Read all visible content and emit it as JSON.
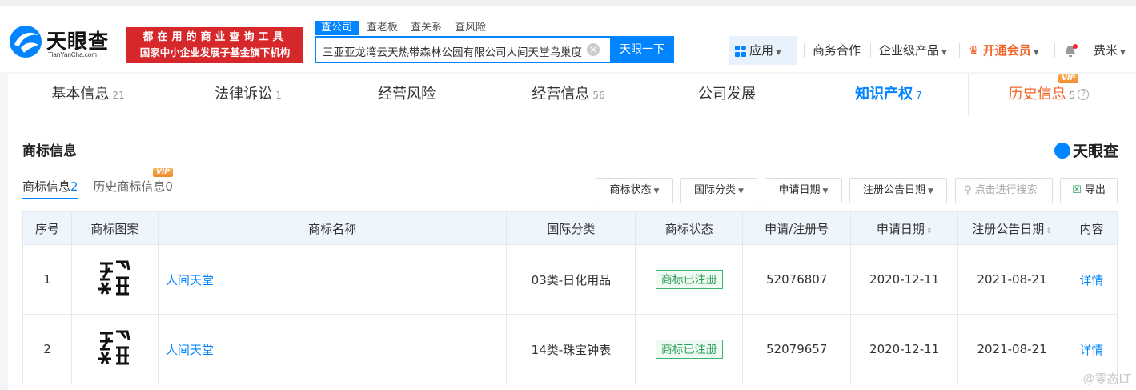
{
  "brand": {
    "name": "天眼查",
    "url": "TianYanCha.com"
  },
  "slogan": {
    "line1": "都在用的商业查询工具",
    "line2": "国家中小企业发展子基金旗下机构"
  },
  "search": {
    "tabs": [
      "查公司",
      "查老板",
      "查关系",
      "查风险"
    ],
    "query": "三亚亚龙湾云天热带森林公园有限公司人间天堂鸟巢度",
    "button": "天眼一下"
  },
  "nav": {
    "app": "应用",
    "biz": "商务合作",
    "enterprise": "企业级产品",
    "vip": "开通会员",
    "user": "费米"
  },
  "tabs": [
    {
      "label": "基本信息",
      "count": "21"
    },
    {
      "label": "法律诉讼",
      "count": "1"
    },
    {
      "label": "经营风险",
      "count": ""
    },
    {
      "label": "经营信息",
      "count": "56"
    },
    {
      "label": "公司发展",
      "count": ""
    },
    {
      "label": "知识产权",
      "count": "7"
    },
    {
      "label": "历史信息",
      "count": "5",
      "badge": "VIP"
    }
  ],
  "section": {
    "title": "商标信息",
    "logo": "天眼查",
    "subtabs": [
      {
        "label": "商标信息",
        "count": "2"
      },
      {
        "label": "历史商标信息",
        "count": "0",
        "badge": "VIP"
      }
    ],
    "filters": [
      "商标状态",
      "国际分类",
      "申请日期",
      "注册公告日期"
    ],
    "search_placeholder": "点击进行搜索",
    "export": "导出"
  },
  "table": {
    "headers": [
      "序号",
      "商标图案",
      "商标名称",
      "国际分类",
      "商标状态",
      "申请/注册号",
      "申请日期",
      "注册公告日期",
      "内容"
    ],
    "rows": [
      {
        "no": "1",
        "name": "人间天堂",
        "cls": "03类-日化用品",
        "status": "商标已注册",
        "reg": "52076807",
        "apply": "2020-12-11",
        "pub": "2021-08-21",
        "detail": "详情"
      },
      {
        "no": "2",
        "name": "人间天堂",
        "cls": "14类-珠宝钟表",
        "status": "商标已注册",
        "reg": "52079657",
        "apply": "2020-12-11",
        "pub": "2021-08-21",
        "detail": "详情"
      }
    ]
  },
  "watermark": "@零态LT"
}
